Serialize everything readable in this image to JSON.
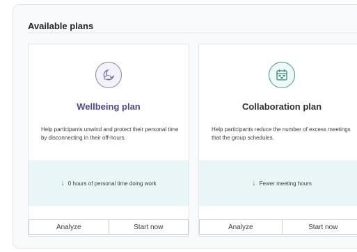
{
  "section_title": "Available plans",
  "colors": {
    "purple": "#4f4791",
    "teal": "#3c9a8b",
    "green_arrow": "#2d9c5d"
  },
  "plans": [
    {
      "icon": "moon-cloud-icon",
      "title": "Wellbeing plan",
      "description": "Help participants unwind and protect their personal time by disconnecting in their off-hours.",
      "metric_icon": "arrow-down-icon",
      "metric": "0 hours of personal time doing work",
      "actions": [
        "Analyze",
        "Start now"
      ]
    },
    {
      "icon": "calendar-grid-icon",
      "title": "Collaboration plan",
      "description": "Help participants reduce the number of excess meetings that the group schedules.",
      "metric_icon": "arrow-down-icon",
      "metric": "Fewer meeting hours",
      "actions": [
        "Analyze",
        "Start now"
      ]
    }
  ]
}
